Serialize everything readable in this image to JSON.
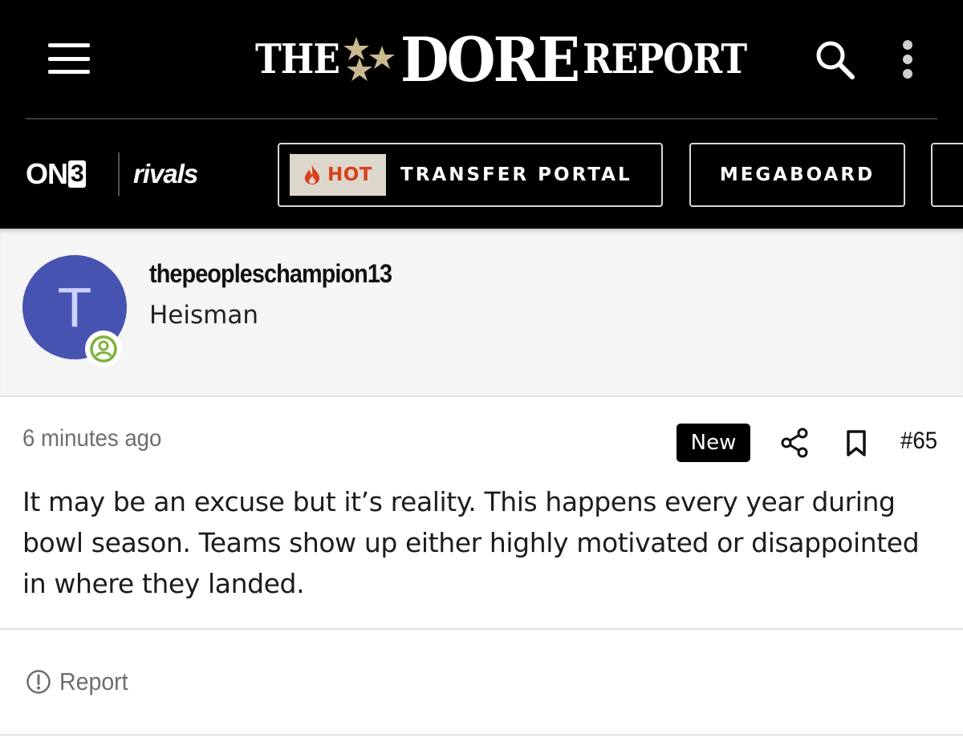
{
  "header": {
    "logo": {
      "the": "THE",
      "dore": "DORE",
      "report": "REPORT"
    },
    "brands": {
      "on": "ON",
      "three": "3",
      "rivals": "rivals"
    },
    "nav": {
      "hot_label": "HOT",
      "transfer_label": "TRANSFER PORTAL",
      "megaboard_label": "MEGABOARD"
    },
    "icons": [
      "menu-icon",
      "search-icon",
      "more-vertical-icon",
      "fire-icon"
    ]
  },
  "user": {
    "avatar_letter": "T",
    "username": "thepeopleschampion13",
    "rank": "Heisman"
  },
  "post": {
    "timestamp": "6 minutes ago",
    "badge": "New",
    "number": "#65",
    "body": "It may be an excuse but it’s reality. This happens every year during bowl season. Teams show up either highly motivated or disappointed in where they landed.",
    "report_label": "Report"
  },
  "colors": {
    "header_bg": "#000000",
    "avatar_bg": "#4753b0",
    "status_green": "#7db33b",
    "hot_text": "#d8401c",
    "hot_bg": "#ddd6cc",
    "logo_star": "#c9b98f"
  }
}
